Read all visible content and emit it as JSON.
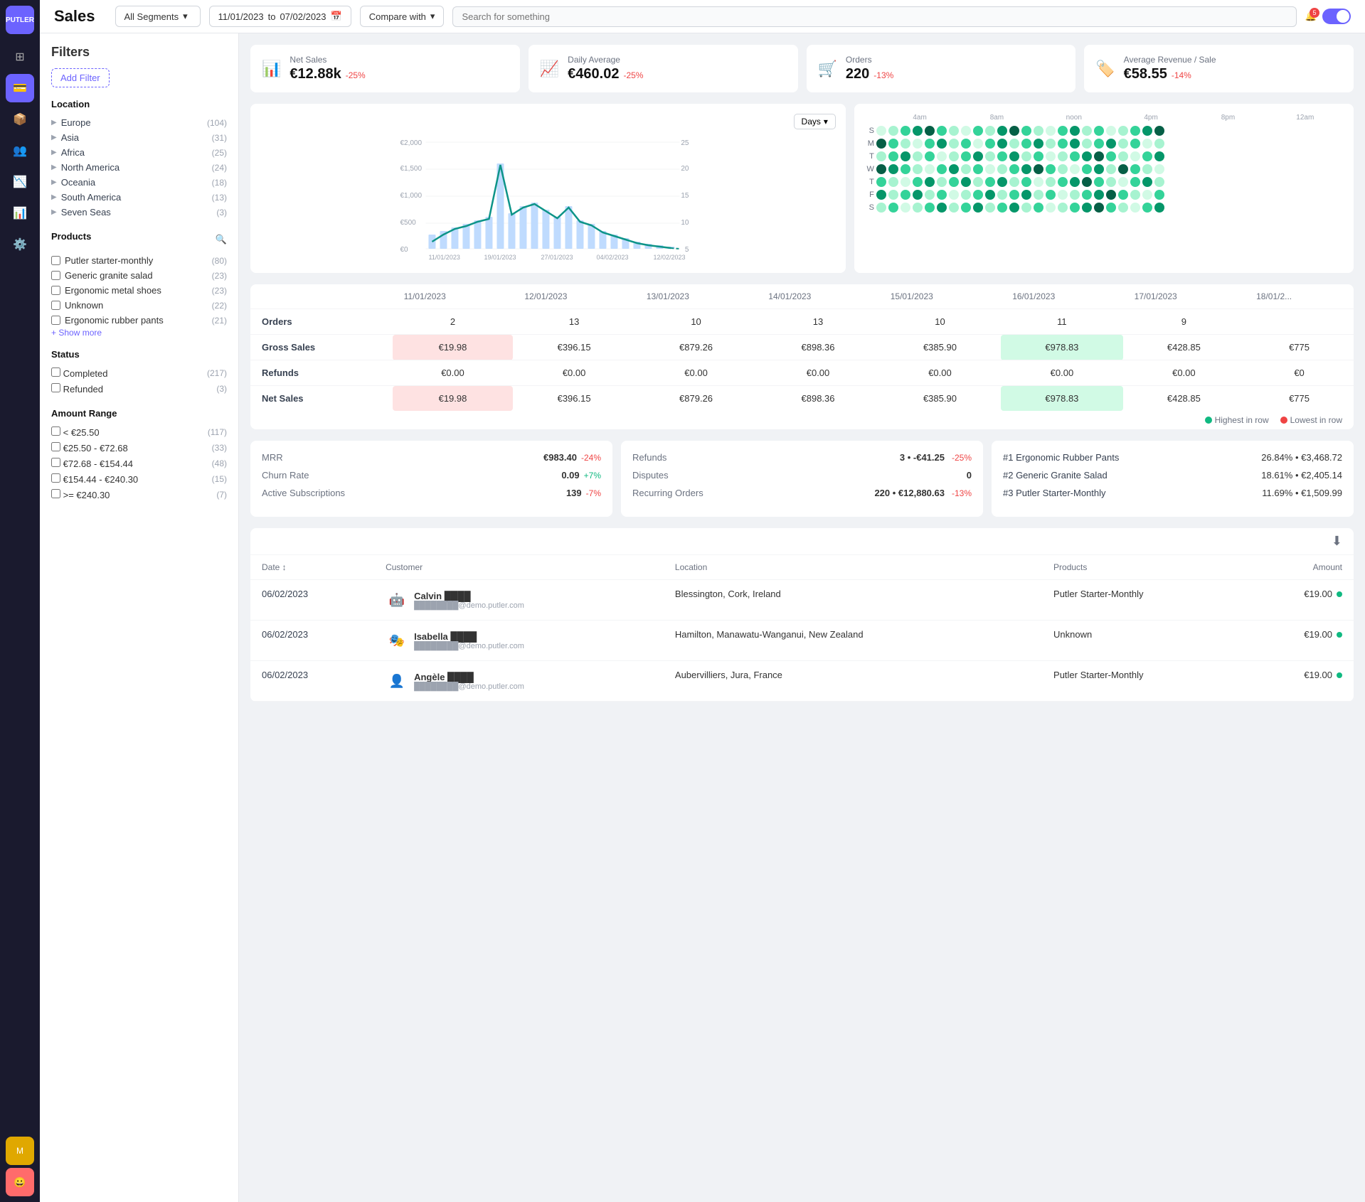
{
  "app": {
    "name": "PUTLER",
    "page_title": "Sales"
  },
  "topbar": {
    "segment_label": "All Segments",
    "date_from": "11/01/2023",
    "date_to": "07/02/2023",
    "compare_label": "Compare with",
    "search_placeholder": "Search for something",
    "notification_count": "5"
  },
  "filters": {
    "title": "Filters",
    "add_filter_label": "Add Filter",
    "location": {
      "title": "Location",
      "items": [
        {
          "name": "Europe",
          "count": "104"
        },
        {
          "name": "Asia",
          "count": "31"
        },
        {
          "name": "Africa",
          "count": "25"
        },
        {
          "name": "North America",
          "count": "24"
        },
        {
          "name": "Oceania",
          "count": "18"
        },
        {
          "name": "South America",
          "count": "13"
        },
        {
          "name": "Seven Seas",
          "count": "3"
        }
      ]
    },
    "products": {
      "title": "Products",
      "items": [
        {
          "name": "Putler starter-monthly",
          "count": "80"
        },
        {
          "name": "Generic granite salad",
          "count": "23"
        },
        {
          "name": "Ergonomic metal shoes",
          "count": "23"
        },
        {
          "name": "Unknown",
          "count": "22"
        },
        {
          "name": "Ergonomic rubber pants",
          "count": "21"
        }
      ],
      "show_more": "+ Show more"
    },
    "status": {
      "title": "Status",
      "items": [
        {
          "name": "Completed",
          "count": "217"
        },
        {
          "name": "Refunded",
          "count": "3"
        }
      ]
    },
    "amount_range": {
      "title": "Amount Range",
      "items": [
        {
          "name": "< €25.50",
          "count": "117"
        },
        {
          "name": "€25.50 - €72.68",
          "count": "33"
        },
        {
          "name": "€72.68 - €154.44",
          "count": "48"
        },
        {
          "name": "€154.44 - €240.30",
          "count": "15"
        },
        {
          "name": ">= €240.30",
          "count": "7"
        }
      ]
    }
  },
  "kpis": [
    {
      "label": "Net Sales",
      "value": "€12.88k",
      "change": "-25%",
      "type": "negative",
      "icon": "📊"
    },
    {
      "label": "Daily Average",
      "value": "€460.02",
      "change": "-25%",
      "type": "negative",
      "icon": "📈"
    },
    {
      "label": "Orders",
      "value": "220",
      "change": "-13%",
      "type": "negative",
      "icon": "🛒"
    },
    {
      "label": "Average Revenue / Sale",
      "value": "€58.55",
      "change": "-14%",
      "type": "negative",
      "icon": "🏷️"
    }
  ],
  "chart": {
    "days_label": "Days",
    "y_labels": [
      "€2,000",
      "€1,500",
      "€1,000",
      "€500",
      "€0"
    ],
    "x_labels": [
      "11/01/2023",
      "19/01/2023",
      "27/01/2023",
      "04/02/2023",
      "12/02/2023"
    ]
  },
  "heatmap": {
    "time_labels": [
      "4am",
      "8am",
      "noon",
      "4pm",
      "8pm",
      "12am"
    ],
    "days": [
      "S",
      "M",
      "T",
      "W",
      "T",
      "F",
      "S"
    ],
    "highest_label": "Highest in row",
    "lowest_label": "Lowest in row"
  },
  "data_table": {
    "columns": [
      "",
      "11/01/2023",
      "12/01/2023",
      "13/01/2023",
      "14/01/2023",
      "15/01/2023",
      "16/01/2023",
      "17/01/2023",
      "18/01/2..."
    ],
    "rows": [
      {
        "label": "Orders",
        "values": [
          "2",
          "13",
          "10",
          "13",
          "10",
          "11",
          "9",
          ""
        ]
      },
      {
        "label": "Gross Sales",
        "values": [
          "€19.98",
          "€396.15",
          "€879.26",
          "€898.36",
          "€385.90",
          "€978.83",
          "€428.85",
          "€775"
        ]
      },
      {
        "label": "Refunds",
        "values": [
          "€0.00",
          "€0.00",
          "€0.00",
          "€0.00",
          "€0.00",
          "€0.00",
          "€0.00",
          "€0"
        ]
      },
      {
        "label": "Net Sales",
        "values": [
          "€19.98",
          "€396.15",
          "€879.26",
          "€898.36",
          "€385.90",
          "€978.83",
          "€428.85",
          "€775"
        ]
      }
    ]
  },
  "legend": {
    "highest": "Highest in row",
    "lowest": "Lowest in row"
  },
  "metrics": {
    "subscriptions": {
      "rows": [
        {
          "label": "MRR",
          "value": "€983.40",
          "change": "-24%",
          "type": "negative"
        },
        {
          "label": "Churn Rate",
          "value": "0.09",
          "change": "+7%",
          "type": "positive"
        },
        {
          "label": "Active Subscriptions",
          "value": "139",
          "change": "-7%",
          "type": "negative"
        }
      ]
    },
    "refunds": {
      "rows": [
        {
          "label": "Refunds",
          "value": "3",
          "extra": "• -€41.25",
          "change": "-25%",
          "type": "negative"
        },
        {
          "label": "Disputes",
          "value": "0",
          "extra": ""
        },
        {
          "label": "Recurring Orders",
          "value": "220",
          "extra": "• €12,880.63",
          "change": "-13%",
          "type": "negative"
        }
      ]
    },
    "top_products": [
      {
        "rank": "#1 Ergonomic Rubber Pants",
        "pct": "26.84% •",
        "revenue": "€3,468.72"
      },
      {
        "rank": "#2 Generic Granite Salad",
        "pct": "18.61% •",
        "revenue": "€2,405.14"
      },
      {
        "rank": "#3 Putler Starter-Monthly",
        "pct": "11.69% •",
        "revenue": "€1,509.99"
      }
    ]
  },
  "transactions": {
    "columns": [
      "Date",
      "Customer",
      "Location",
      "Products",
      "Amount"
    ],
    "rows": [
      {
        "date": "06/02/2023",
        "customer_name": "Calvin ████",
        "customer_email": "████████@demo.putler.com",
        "customer_emoji": "🤖",
        "location": "Blessington, Cork, Ireland",
        "product": "Putler Starter-Monthly",
        "amount": "€19.00",
        "status": "green"
      },
      {
        "date": "06/02/2023",
        "customer_name": "Isabella ████",
        "customer_email": "████████@demo.putler.com",
        "customer_emoji": "🎭",
        "location": "Hamilton, Manawatu-Wanganui, New Zealand",
        "product": "Unknown",
        "amount": "€19.00",
        "status": "green"
      },
      {
        "date": "06/02/2023",
        "customer_name": "Angèle ████",
        "customer_email": "████████@demo.putler.com",
        "customer_emoji": "👤",
        "location": "Aubervilliers, Jura, France",
        "product": "Putler Starter-Monthly",
        "amount": "€19.00",
        "status": "green"
      }
    ]
  }
}
